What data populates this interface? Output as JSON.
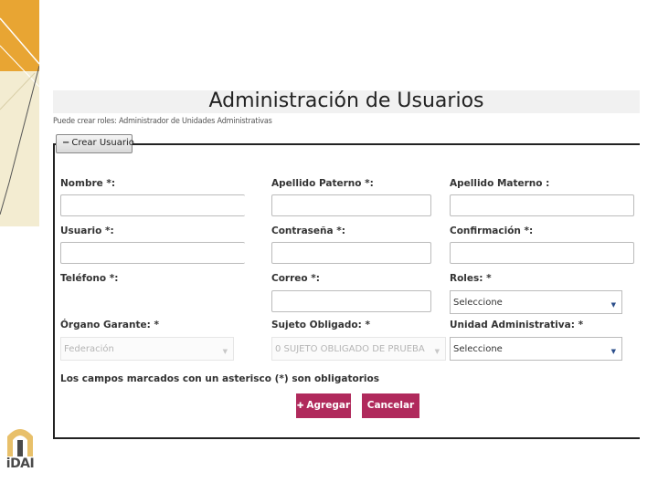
{
  "brand": {
    "logo_text": "iDAI",
    "gold": "#e8a533",
    "accent": "#b02a5c"
  },
  "header": {
    "title": "Administración de Usuarios",
    "subtitle": "Puede crear roles: Administrador de Unidades Administrativas"
  },
  "panel": {
    "legend_label": "Crear Usuario",
    "legend_icon": "minus-icon"
  },
  "form": {
    "nombre_label": "Nombre *:",
    "nombre_value": "",
    "apellido_paterno_label": "Apellido Paterno *:",
    "apellido_paterno_value": "",
    "apellido_materno_label": "Apellido Materno :",
    "apellido_materno_value": "",
    "usuario_label": "Usuario *:",
    "usuario_value": "",
    "contrasena_label": "Contraseña *:",
    "contrasena_value": "",
    "confirmacion_label": "Confirmación *:",
    "confirmacion_value": "",
    "telefono_label": "Teléfono *:",
    "correo_label": "Correo *:",
    "correo_value": "",
    "roles_label": "Roles: *",
    "roles_selected": "Seleccione",
    "organo_label": "Órgano Garante: *",
    "organo_selected": "Federación",
    "sujeto_label": "Sujeto Obligado: *",
    "sujeto_selected": "0 SUJETO OBLIGADO DE PRUEBA",
    "unidad_label": "Unidad Administrativa: *",
    "unidad_selected": "Seleccione",
    "required_note": "Los campos marcados con un asterisco (*) son obligatorios"
  },
  "actions": {
    "agregar_label": "Agregar",
    "agregar_icon": "plus-icon",
    "cancelar_label": "Cancelar"
  }
}
